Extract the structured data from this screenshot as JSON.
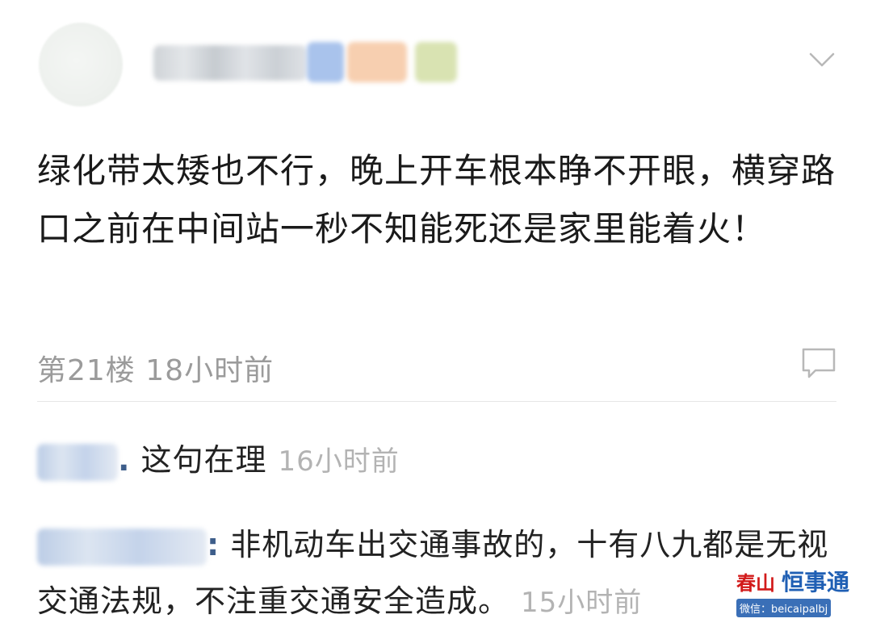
{
  "comment": {
    "text": "绿化带太矮也不行，晚上开车根本睁不开眼，横穿路口之前在中间站一秒不知能死还是家里能着火！",
    "floor": "第21楼",
    "time": "18小时前"
  },
  "replies": [
    {
      "separator": ".",
      "text": "这句在理",
      "time": "16小时前"
    },
    {
      "separator": ":",
      "text": "非机动车出交通事故的，十有八九都是无视交通法规，不注重交通安全造成。",
      "time": "15小时前"
    }
  ],
  "watermark": {
    "logo": "春山",
    "name": "恒事通",
    "sub": "微信：beicaipalbj"
  },
  "icons": {
    "collapse": "chevron-down-icon",
    "reply": "comment-bubble-icon"
  },
  "colors": {
    "text": "#1a1a1a",
    "meta": "#9b9b9b",
    "reply_time": "#b3b3b3",
    "link_colon": "#3d5d8a"
  }
}
